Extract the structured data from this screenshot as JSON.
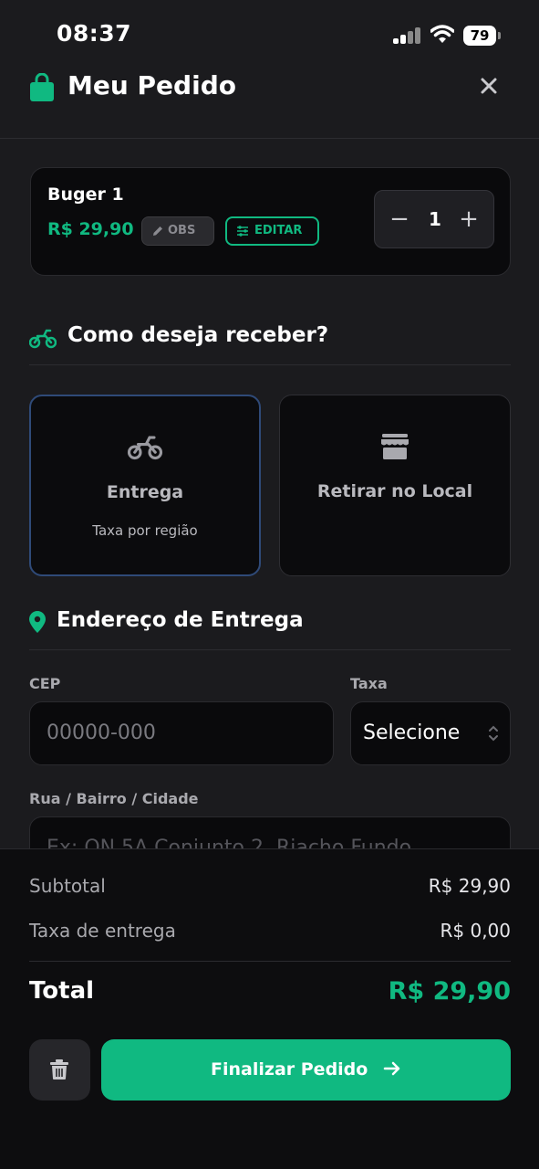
{
  "status_bar": {
    "time": "08:37",
    "battery": "79"
  },
  "header": {
    "title": "Meu Pedido"
  },
  "cart_item": {
    "name": "Buger 1",
    "price": "R$ 29,90",
    "obs_label": "OBS",
    "edit_label": "EDITAR",
    "minus": "−",
    "quantity": "1",
    "plus": "+"
  },
  "receive_section": {
    "title": "Como deseja receber?",
    "options": [
      {
        "label": "Entrega",
        "sub": "Taxa por região",
        "icon": "motorcycle-icon",
        "selected": true
      },
      {
        "label": "Retirar no Local",
        "sub": "",
        "icon": "storefront-icon",
        "selected": false
      }
    ]
  },
  "address_section": {
    "title": "Endereço de Entrega",
    "cep_label": "CEP",
    "cep_placeholder": "00000-000",
    "fee_label": "Taxa",
    "fee_value": "Selecione",
    "street_label": "Rua / Bairro / Cidade",
    "street_placeholder": "Ex: QN 5A Conjunto 2, Riacho Fundo"
  },
  "summary": {
    "subtotal_label": "Subtotal",
    "subtotal_value": "R$ 29,90",
    "delivery_fee_label": "Taxa de entrega",
    "delivery_fee_value": "R$ 0,00",
    "total_label": "Total",
    "total_value": "R$ 29,90"
  },
  "actions": {
    "finish_label": "Finalizar Pedido"
  },
  "colors": {
    "accent": "#10b981",
    "background": "#1b1b1e",
    "card": "#0a0a0c",
    "selected_border": "#2f4a78"
  }
}
